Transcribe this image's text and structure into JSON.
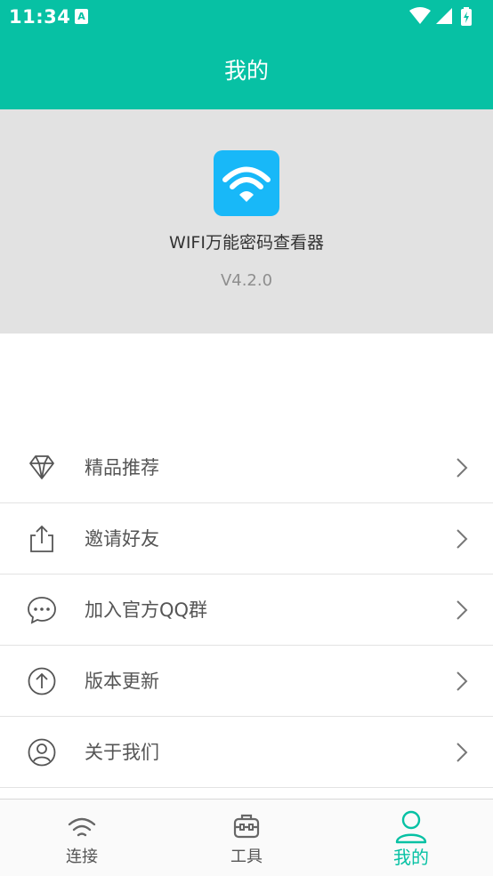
{
  "status_bar": {
    "time": "11:34",
    "notification_icon": "A"
  },
  "header": {
    "title": "我的"
  },
  "app_info": {
    "name": "WIFI万能密码查看器",
    "version": "V4.2.0"
  },
  "menu": {
    "items": [
      {
        "label": "精品推荐",
        "icon": "diamond-icon"
      },
      {
        "label": "邀请好友",
        "icon": "share-icon"
      },
      {
        "label": "加入官方QQ群",
        "icon": "chat-bubble-icon"
      },
      {
        "label": "版本更新",
        "icon": "arrow-up-circle-icon"
      },
      {
        "label": "关于我们",
        "icon": "user-circle-icon"
      }
    ]
  },
  "tabs": [
    {
      "label": "连接",
      "icon": "wifi-icon",
      "active": false
    },
    {
      "label": "工具",
      "icon": "toolbox-icon",
      "active": false
    },
    {
      "label": "我的",
      "icon": "user-icon",
      "active": true
    }
  ],
  "colors": {
    "accent": "#07C1A4",
    "app_icon_bg": "#18B8F8",
    "hero_bg": "#e2e2e2"
  }
}
